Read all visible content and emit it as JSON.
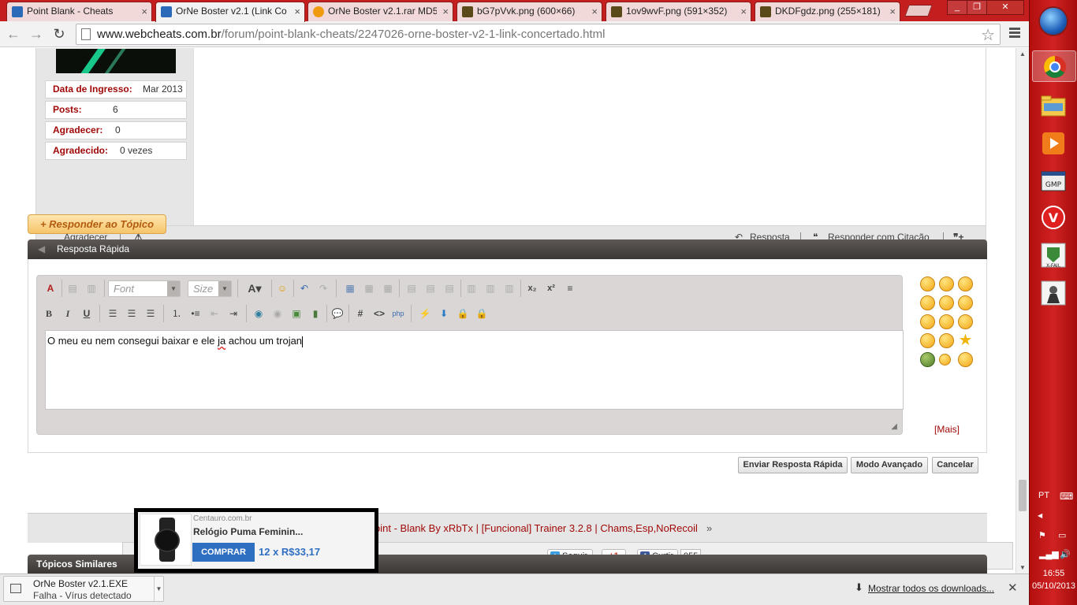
{
  "browser": {
    "tabs": [
      {
        "title": "Point Blank - Cheats",
        "favicon_color": "#2a6ab8",
        "active": false
      },
      {
        "title": "OrNe Boster v2.1 (Link Co",
        "favicon_color": "#2a6ab8",
        "active": true
      },
      {
        "title": "OrNe Boster v2.1.rar MD5:",
        "favicon_color": "#f09a10",
        "active": false
      },
      {
        "title": "bG7pVvk.png (600×66)",
        "favicon_color": "#5a4a1a",
        "active": false
      },
      {
        "title": "1ov9wvF.png (591×352)",
        "favicon_color": "#5a4a1a",
        "active": false
      },
      {
        "title": "DKDFgdz.png (255×181)",
        "favicon_color": "#5a4a1a",
        "active": false
      }
    ],
    "url_host": "www.webcheats.com.br",
    "url_path": "/forum/point-blank-cheats/2247026-orne-boster-v2-1-link-concertado.html"
  },
  "post": {
    "user_info": [
      {
        "label": "Data de Ingresso:",
        "value": "Mar 2013"
      },
      {
        "label": "Posts:",
        "value": "6"
      },
      {
        "label": "Agradecer:",
        "value": "0"
      },
      {
        "label": "Agradecido:",
        "value": "0 vezes"
      }
    ],
    "footer": {
      "thank": "Agradecer",
      "reply": "Resposta",
      "reply_quote": "Responder com Citação"
    }
  },
  "reply_topic_button": "+ Responder ao Tópico",
  "quick_reply": {
    "title": "Resposta Rápida",
    "font_placeholder": "Font",
    "size_placeholder": "Size",
    "text_before": "O meu eu nem consegui baixar e ele ",
    "text_misspelled": "ja",
    "text_after": " achou um trojan",
    "more_label": "[Mais]",
    "buttons": {
      "send": "Enviar Resposta Rápida",
      "advanced": "Modo Avançado",
      "cancel": "Cancelar"
    }
  },
  "nav_thread": "oint - Blank By xRbTx | [Funcional] Trainer 3.2.8 | Chams,Esp,NoRecoil",
  "similar_topics": "Tópicos Similares",
  "ad": {
    "source": "Centauro.com.br",
    "product": "Relógio Puma Feminin...",
    "buy": "COMPRAR",
    "price": "12 x R$33,17"
  },
  "share": {
    "twitter": "Seguir",
    "gplus": "+1",
    "facebook": "Curtir",
    "fb_count": "955"
  },
  "download": {
    "filename": "OrNe Boster v2.1.EXE",
    "status": "Falha - Vírus detectado",
    "show_all": "Mostrar todos os downloads..."
  },
  "system": {
    "language": "PT",
    "time": "16:55",
    "date": "05/10/2013"
  }
}
